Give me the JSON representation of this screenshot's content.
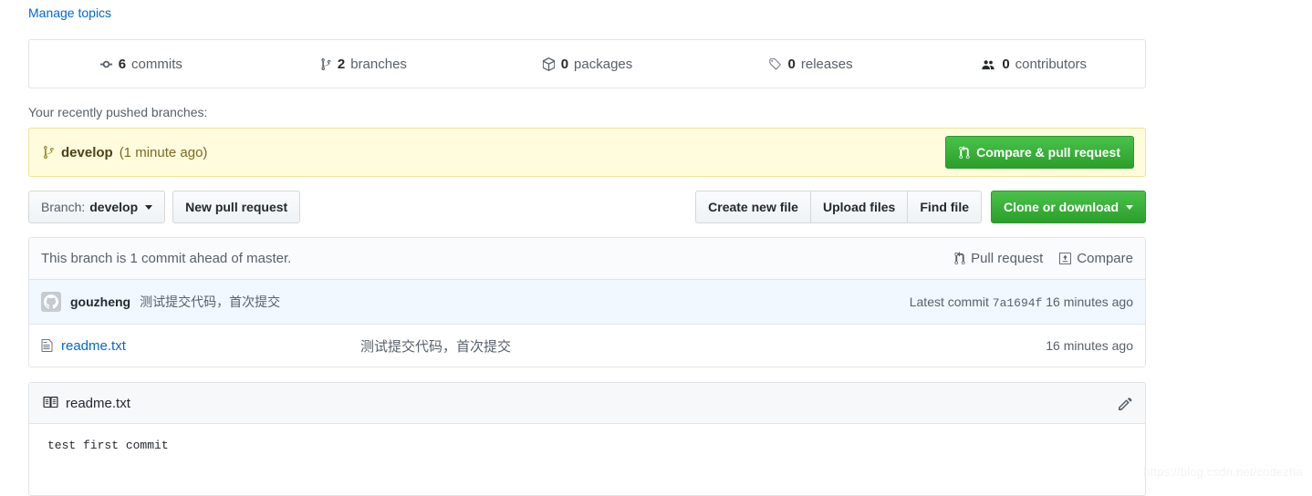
{
  "topics": {
    "manage_label": "Manage topics"
  },
  "stats": [
    {
      "icon": "commit-icon",
      "count": "6",
      "label": "commits"
    },
    {
      "icon": "branch-icon",
      "count": "2",
      "label": "branches"
    },
    {
      "icon": "package-icon",
      "count": "0",
      "label": "packages"
    },
    {
      "icon": "tag-icon",
      "count": "0",
      "label": "releases"
    },
    {
      "icon": "contributors-icon",
      "count": "0",
      "label": "contributors"
    }
  ],
  "pushed": {
    "label": "Your recently pushed branches:",
    "branch_name": "develop",
    "branch_time": "(1 minute ago)",
    "compare_button": "Compare & pull request"
  },
  "toolbar": {
    "branch_prefix": "Branch:",
    "branch_value": "develop",
    "new_pull_request": "New pull request",
    "create_new_file": "Create new file",
    "upload_files": "Upload files",
    "find_file": "Find file",
    "clone_or_download": "Clone or download"
  },
  "branch_status": {
    "text": "This branch is 1 commit ahead of master.",
    "pull_request_link": "Pull request",
    "compare_link": "Compare"
  },
  "latest_commit": {
    "author": "gouzheng",
    "message": "测试提交代码，首次提交",
    "prefix": "Latest commit",
    "sha": "7a1694f",
    "time": "16 minutes ago"
  },
  "files": [
    {
      "name": "readme.txt",
      "message": "测试提交代码，首次提交",
      "time": "16 minutes ago"
    }
  ],
  "readme": {
    "title": "readme.txt",
    "content": "test first commit"
  },
  "watermark": "https://blog.csdn.net/codezha",
  "colors": {
    "link": "#0366d6",
    "green_button": "#2aa02a",
    "banner_yellow": "#fffbdd",
    "commit_row_blue": "#f1f8ff",
    "border": "#e1e4e8"
  }
}
